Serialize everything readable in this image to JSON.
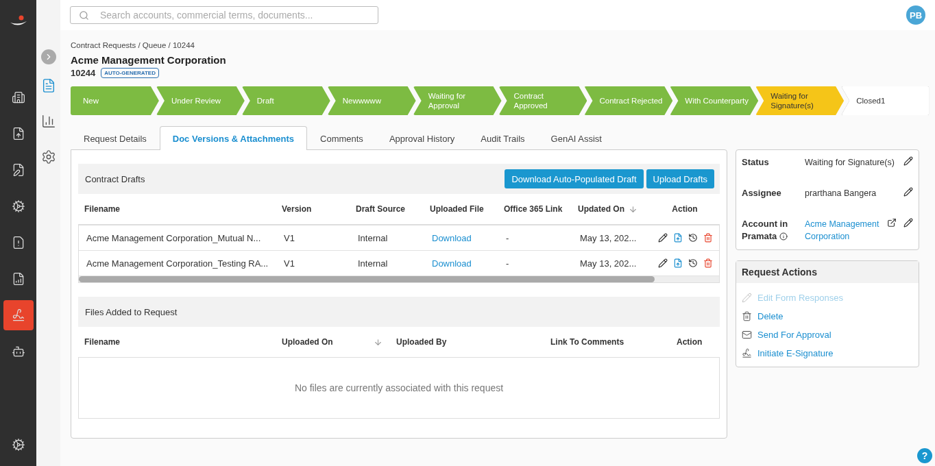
{
  "nav_rail": [
    {
      "selected": false
    },
    {
      "selected": false
    },
    {
      "selected": false
    },
    {
      "selected": false
    },
    {
      "selected": false
    },
    {
      "selected": false
    },
    {
      "selected": true
    },
    {
      "selected": false
    }
  ],
  "sub_rail": [
    {
      "selected": true
    },
    {
      "selected": false
    },
    {
      "selected": false
    }
  ],
  "search": {
    "placeholder": "Search accounts, commercial terms, documents..."
  },
  "avatar": "PB",
  "breadcrumb": "Contract Requests / Queue / 10244",
  "title": "Acme Management Corporation",
  "request_id": "10244",
  "badge": "AUTO-GENERATED",
  "stages": [
    {
      "label": "New",
      "completed": true,
      "current": false
    },
    {
      "label": "Under Review",
      "completed": true,
      "current": false
    },
    {
      "label": "Draft",
      "completed": true,
      "current": false
    },
    {
      "label": "Newwwww",
      "completed": true,
      "current": false
    },
    {
      "label": "Waiting for Approval",
      "completed": true,
      "current": false
    },
    {
      "label": "Contract Approved",
      "completed": true,
      "current": false
    },
    {
      "label": "Contract Rejected",
      "completed": true,
      "current": false
    },
    {
      "label": "With Counterparty",
      "completed": true,
      "current": false
    },
    {
      "label": "Waiting for Signature(s)",
      "completed": false,
      "current": true
    },
    {
      "label": "Closed1",
      "completed": false,
      "current": false
    }
  ],
  "tabs": [
    {
      "label": "Request Details",
      "selected": false
    },
    {
      "label": "Doc Versions & Attachments",
      "selected": true
    },
    {
      "label": "Comments",
      "selected": false
    },
    {
      "label": "Approval History",
      "selected": false
    },
    {
      "label": "Audit Trails",
      "selected": false
    },
    {
      "label": "GenAI Assist",
      "selected": false
    }
  ],
  "drafts": {
    "title": "Contract Drafts",
    "buttons": [
      "Download Auto-Populated Draft",
      "Upload Drafts"
    ],
    "columns": [
      "Filename",
      "Version",
      "Draft Source",
      "Uploaded File",
      "Office 365 Link",
      "Updated On",
      "Action"
    ],
    "rows": [
      {
        "filename": "Acme Management Corporation_Mutual N...",
        "version": "V1",
        "source": "Internal",
        "file": "Download",
        "link": "-",
        "updated": "May 13, 202..."
      },
      {
        "filename": "Acme Management Corporation_Testing RA...",
        "version": "V1",
        "source": "Internal",
        "file": "Download",
        "link": "-",
        "updated": "May 13, 202..."
      }
    ]
  },
  "files": {
    "title": "Files Added to Request",
    "columns": [
      "Filename",
      "Uploaded On",
      "Uploaded By",
      "Link To Comments",
      "Action"
    ],
    "empty": "No files are currently associated with this request"
  },
  "details": [
    {
      "label": "Status",
      "value": "Waiting for Signature(s)",
      "kind": "text"
    },
    {
      "label": "Assignee",
      "value": "prarthana Bangera",
      "kind": "text"
    },
    {
      "label": "Account in Pramata",
      "value": "Acme Management Corporation",
      "kind": "link"
    }
  ],
  "actions": {
    "title": "Request Actions",
    "items": [
      {
        "label": "Edit Form Responses",
        "disabled": true
      },
      {
        "label": "Delete",
        "disabled": false
      },
      {
        "label": "Send For Approval",
        "disabled": false
      },
      {
        "label": "Initiate E-Signature",
        "disabled": false
      }
    ]
  },
  "help": "?"
}
